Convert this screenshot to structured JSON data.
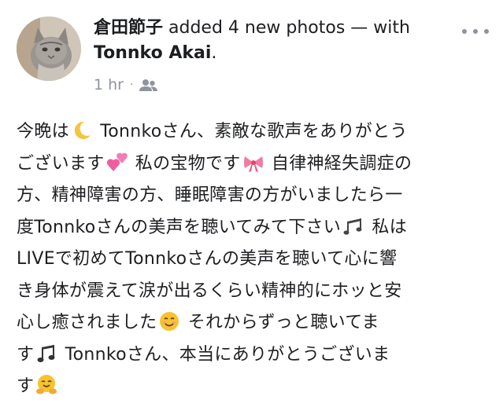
{
  "header": {
    "author": "倉田節子",
    "action": " added 4 new photos — with ",
    "tagged": "Tonnko Akai",
    "end": ".",
    "time": "1 hr",
    "dot": "·"
  },
  "icons": {
    "audience": "friends-icon",
    "more": "more-options-icon"
  },
  "post": {
    "l1a": "今晩は",
    "l1b": " Tonnkoさん、素敵な歌声をありがとう",
    "l2a": "ございます",
    "l2b": " 私の宝物です",
    "l2c": " 自律神経失調症の",
    "l3": "方、精神障害の方、睡眠障害の方がいましたら一",
    "l4a": "度Tonnkoさんの美声を聴いてみて下さい",
    "l4b": " 私は",
    "l5": "LIVEで初めてTonnkoさんの美声を聴いて心に響",
    "l6": "き身体が震えて涙が出るくらい精神的にホッと安",
    "l7a": "心し癒されました",
    "l7b": " それからずっと聴いてま",
    "l8a": "す",
    "l8b": " Tonnkoさん、本当にありがとうございま",
    "l9": "す"
  }
}
